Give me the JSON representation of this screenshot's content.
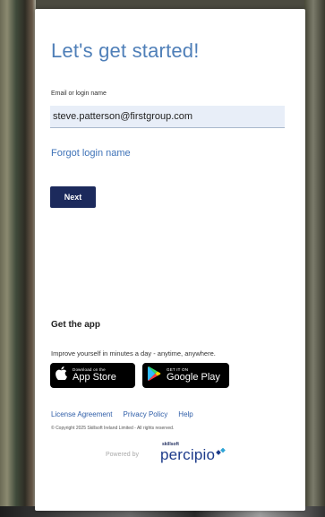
{
  "login": {
    "title": "Let's get started!",
    "field_label": "Email or login name",
    "field_value": "steve.patterson@firstgroup.com",
    "forgot_link": "Forgot login name",
    "next_button": "Next"
  },
  "app": {
    "heading": "Get the app",
    "tagline": "Improve yourself in minutes a day - anytime, anywhere.",
    "apple": {
      "small": "Download on the",
      "big": "App Store",
      "icon": "apple-icon"
    },
    "google": {
      "small": "GET IT ON",
      "big": "Google Play",
      "icon": "google-play-icon"
    }
  },
  "footer": {
    "links": [
      "License Agreement",
      "Privacy Policy",
      "Help"
    ],
    "copyright": "© Copyright 2025 Skillsoft Ireland Limited - All rights reserved.",
    "powered_by": "Powered by",
    "brand_small": "skillsoft",
    "brand_big": "percipio",
    "brand_icon": "percipio-logo-icon"
  },
  "colors": {
    "title": "#4f7fb8",
    "link": "#3f73b8",
    "button": "#1c2a5c",
    "field_bg": "#e8eef8"
  }
}
